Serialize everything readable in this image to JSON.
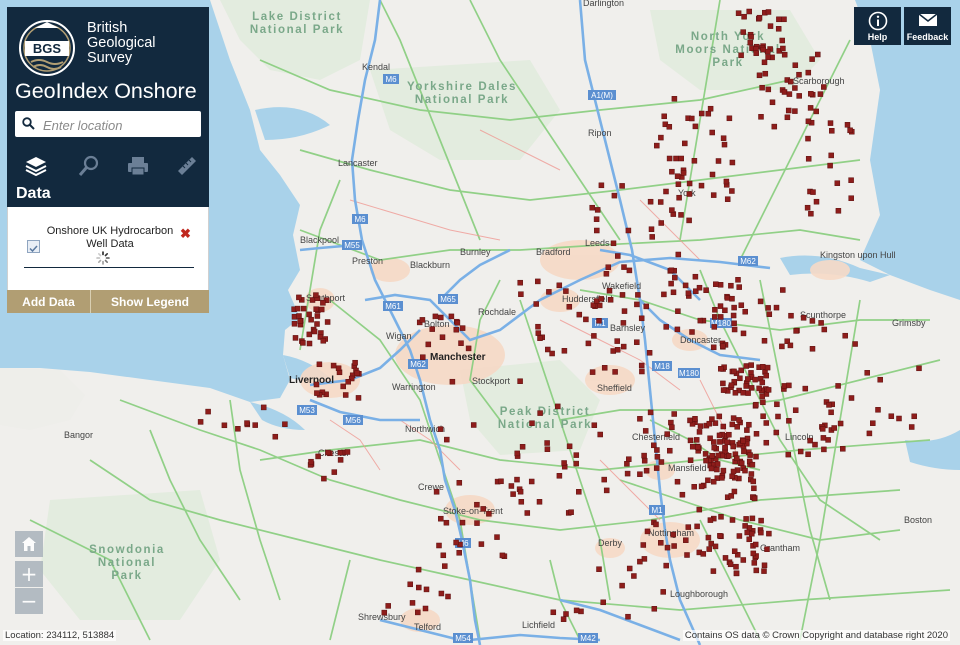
{
  "brand": {
    "logo_text": "BGS",
    "org_line1": "British",
    "org_line2": "Geological",
    "org_line3": "Survey",
    "navy": "#12293e",
    "gold": "#b19e73"
  },
  "app_title": "GeoIndex Onshore",
  "search": {
    "placeholder": "Enter location",
    "value": ""
  },
  "toolbar": {
    "icons": [
      "layers-icon",
      "search-icon",
      "print-icon",
      "ruler-icon"
    ]
  },
  "data_section": {
    "title": "Data",
    "layer": {
      "name_line1": "Onshore UK Hydrocarbon",
      "name_line2": "Well Data",
      "checked": true,
      "status": "loading"
    },
    "add_data_label": "Add Data",
    "show_legend_label": "Show Legend"
  },
  "top_right": {
    "help_label": "Help",
    "feedback_label": "Feedback"
  },
  "zoom": {
    "in_label": "+",
    "out_label": "−"
  },
  "status_bar": {
    "location_text": "Location: 234112, 513884",
    "attribution": "Contains OS data © Crown Copyright and database right 2020"
  },
  "map": {
    "well_color": "#8e1d1b",
    "parks": [
      {
        "line1": "Lake District",
        "line2": "National Park"
      },
      {
        "line1": "Yorkshire Dales",
        "line2": "National Park"
      },
      {
        "line1": "North York",
        "line2": "Moors National",
        "line3": "Park"
      },
      {
        "line1": "Peak District",
        "line2": "National Park"
      },
      {
        "line1": "Snowdonia",
        "line2": "National",
        "line3": "Park"
      }
    ],
    "cities": [
      "Manchester",
      "Liverpool"
    ],
    "towns": [
      "Darlington",
      "Kendal",
      "Scarborough",
      "Ripon",
      "Lancaster",
      "York",
      "Bradford",
      "Leeds",
      "Blackpool",
      "Preston",
      "Blackburn",
      "Burnley",
      "Kingston upon Hull",
      "Southport",
      "Wakefield",
      "Huddersfield",
      "Scunthorpe",
      "Grimsby",
      "Wigan",
      "Bolton",
      "Rochdale",
      "Barnsley",
      "Doncaster",
      "Warrington",
      "Stockport",
      "Sheffield",
      "Bangor",
      "Northwich",
      "Lincoln",
      "Chester",
      "Chesterfield",
      "Mansfield",
      "Crewe",
      "Stoke-on-Trent",
      "Boston",
      "Derby",
      "Nottingham",
      "Grantham",
      "Loughborough",
      "Shrewsbury",
      "Telford",
      "Lichfield"
    ],
    "roads": [
      "M6",
      "M55",
      "M61",
      "M65",
      "M60",
      "M62",
      "M1",
      "M18",
      "M180",
      "M53",
      "M56",
      "M54",
      "M42",
      "A1(M)"
    ]
  }
}
